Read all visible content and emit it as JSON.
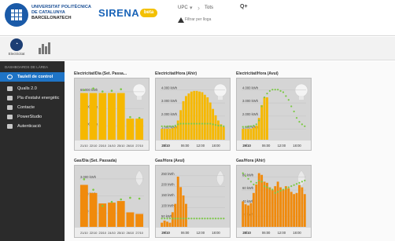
{
  "header": {
    "org_line1": "UNIVERSITAT POLITÈCNICA",
    "org_line2": "DE CATALUNYA",
    "org_line3": "BARCELONATECH",
    "app_name": "SIRENA",
    "beta_badge": "beta",
    "scope_select": "UPC",
    "scope_select2": "Tots",
    "query_button": "Q+",
    "filter_text": "Filtrar per lloga"
  },
  "tabs": {
    "tab1_label": "Electricitat",
    "tab1_icon": "gauge-icon",
    "tab2_icon": "bar-chart-icon"
  },
  "sidebar": {
    "heading": "DASHBOARDS DE LÀREA",
    "items": [
      {
        "label": "Taulell de control",
        "icon": "dashboard-icon",
        "active": true
      },
      {
        "label": "Qualls 2.0",
        "icon": "box-icon"
      },
      {
        "label": "Pla d'estalvi energètic",
        "icon": "box-icon"
      },
      {
        "label": "Contacte",
        "icon": "box-icon"
      },
      {
        "label": "PowerStudio",
        "icon": "box-icon"
      },
      {
        "label": "Autenticació",
        "icon": "box-icon"
      }
    ]
  },
  "cards": [
    {
      "title": "Electricitat/Dia (Set. Passa...",
      "icon": "bulb-icon"
    },
    {
      "title": "Electricitat/Hora (Ahir)",
      "icon": "bulb-icon"
    },
    {
      "title": "Electricitat/Hora (Avui)",
      "icon": "bulb-icon"
    },
    {
      "title": "Gas/Dia (Set. Passada)",
      "icon": "flame-icon"
    },
    {
      "title": "Gas/Hora (Avui)",
      "icon": "flame-icon"
    },
    {
      "title": "Gas/Hora (Ahir)",
      "icon": "flame-icon"
    }
  ],
  "chart_data": [
    {
      "type": "bar",
      "title": "Electricitat/Dia (Set. Passa...",
      "categories": [
        "21/10",
        "22/10",
        "23/10",
        "24/10",
        "25/10",
        "26/10",
        "27/10"
      ],
      "values": [
        62000,
        62000,
        62000,
        62000,
        62000,
        28000,
        28000
      ],
      "overlay": [
        66000,
        68000,
        64000,
        65000,
        67000,
        30000,
        29000
      ],
      "ytick_labels": [
        "60.000 kWh",
        "40.000 kWh",
        "20.000 kWh"
      ],
      "ylim": [
        0,
        75000
      ],
      "bar_color": "#f6b800",
      "overlay_color": "#7ac943"
    },
    {
      "type": "bar",
      "title": "Electricitat/Hora (Ahir)",
      "categories": [
        "28/10",
        "06:00",
        "12:00",
        "18:00"
      ],
      "values": [
        850,
        850,
        850,
        870,
        900,
        1000,
        1500,
        2300,
        3000,
        3400,
        3600,
        3750,
        3800,
        3800,
        3750,
        3700,
        3500,
        3300,
        2900,
        2400,
        1900,
        1500,
        1200,
        1000
      ],
      "overlay": [
        1050,
        1050,
        1050,
        1050,
        1050,
        1100,
        1200,
        1250,
        1250,
        1250,
        1250,
        1250,
        1250,
        1250,
        1250,
        1250,
        1250,
        1250,
        1250,
        1200,
        1150,
        1100,
        1100,
        1050
      ],
      "ytick_labels": [
        "4.000 kWh",
        "3.000 kWh",
        "2.000 kWh",
        "1.000 kWh"
      ],
      "ylim": [
        0,
        4400
      ],
      "bar_color": "#f6b800",
      "overlay_color": "#7ac943"
    },
    {
      "type": "bar",
      "title": "Electricitat/Hora (Avui)",
      "categories": [
        "29/10",
        "06:00",
        "12:00",
        "18:00"
      ],
      "values": [
        850,
        850,
        850,
        870,
        950,
        1100,
        1700,
        2700,
        3300,
        3300
      ],
      "overlay": [
        1000,
        1000,
        1050,
        1050,
        1100,
        1200,
        1500,
        2600,
        3300,
        3600,
        3800,
        3900,
        3900,
        3900,
        3800,
        3700,
        3400,
        3100,
        2600,
        2200,
        1700,
        1400,
        1200,
        1050
      ],
      "ytick_labels": [
        "4.000 kWh",
        "3.000 kWh",
        "2.000 kWh",
        "1.000 kWh"
      ],
      "ylim": [
        0,
        4400
      ],
      "bar_color": "#f6b800",
      "overlay_color": "#7ac943"
    },
    {
      "type": "bar",
      "title": "Gas/Dia (Set. Passada)",
      "categories": [
        "21/10",
        "22/10",
        "23/10",
        "24/10",
        "25/10",
        "26/10",
        "27/10"
      ],
      "values": [
        2600,
        2100,
        1450,
        1500,
        1600,
        900,
        800
      ],
      "overlay": [
        2950,
        2300,
        1300,
        1550,
        1700,
        1800,
        1750
      ],
      "ytick_labels": [
        "3.000 kWh",
        "2.000 kWh",
        "1.000 kWh"
      ],
      "ylim": [
        0,
        3500
      ],
      "bar_color": "#f08a0c",
      "overlay_color": "#7ac943"
    },
    {
      "type": "bar",
      "title": "Gas/Hora (Avui)",
      "categories": [
        "29/10",
        "06:00",
        "12:00",
        "18:00"
      ],
      "values": [
        20,
        30,
        25,
        20,
        70,
        110,
        240,
        190,
        150,
        110
      ],
      "overlay": [
        40,
        40,
        40,
        40,
        40,
        40,
        40,
        40,
        40,
        40,
        40,
        40,
        40,
        40,
        40,
        40,
        40,
        40,
        40,
        40,
        40,
        40,
        40,
        40
      ],
      "ytick_labels": [
        "250 kWh",
        "200 kWh",
        "150 kWh",
        "100 kWh",
        "50 kWh"
      ],
      "ylim": [
        0,
        270
      ],
      "bar_color": "#f08a0c",
      "overlay_color": "#7ac943"
    },
    {
      "type": "bar",
      "title": "Gas/Hora (Ahir)",
      "categories": [
        "28/10",
        "06:00",
        "12:00",
        "18:00"
      ],
      "values": [
        45,
        40,
        38,
        42,
        60,
        75,
        95,
        92,
        80,
        78,
        70,
        65,
        72,
        80,
        70,
        66,
        72,
        68,
        62,
        58,
        60,
        74,
        70,
        58
      ],
      "overlay": [
        95,
        90,
        85,
        80,
        75,
        78,
        82,
        80,
        72,
        70,
        68,
        66,
        60,
        62,
        64,
        66,
        68,
        70,
        72,
        74,
        76,
        78,
        80,
        82
      ],
      "ytick_labels": [
        "80 kWh",
        "60 kWh",
        "40 kWh",
        "20 kWh"
      ],
      "ylim": [
        0,
        100
      ],
      "bar_color": "#f08a0c",
      "overlay_color": "#7ac943"
    }
  ]
}
